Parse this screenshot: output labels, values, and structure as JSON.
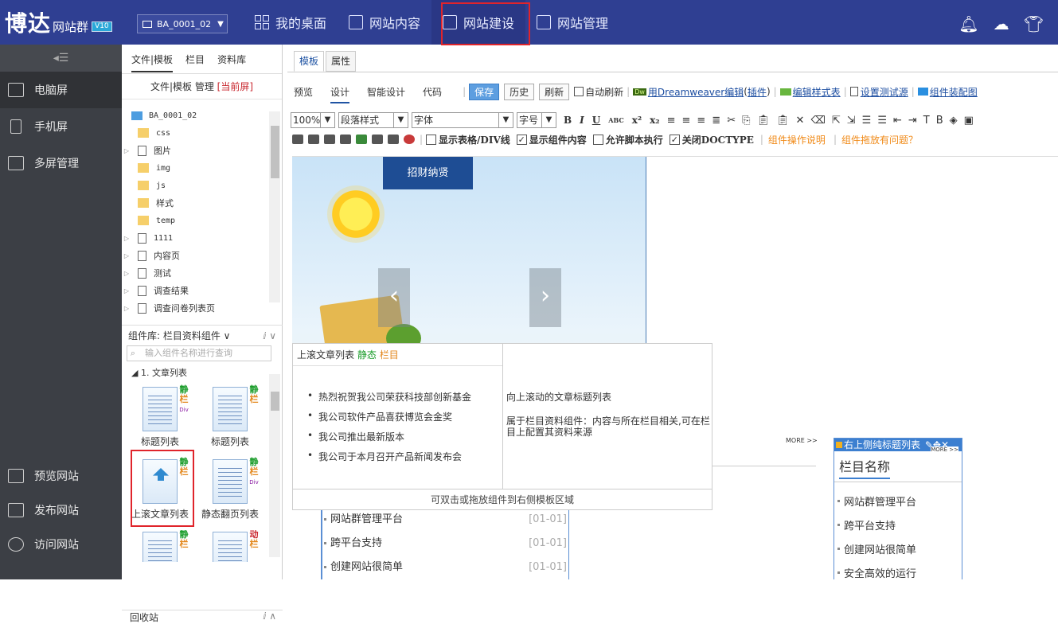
{
  "header": {
    "logo_main": "博达",
    "logo_sub": "网站群",
    "logo_version": "V10",
    "site_code": "BA_0001_02",
    "nav": [
      {
        "label": "我的桌面",
        "icon": "grid-icon"
      },
      {
        "label": "网站内容",
        "icon": "edit-icon"
      },
      {
        "label": "网站建设",
        "icon": "build-icon"
      },
      {
        "label": "网站管理",
        "icon": "manage-icon"
      }
    ],
    "active_nav": "网站建设",
    "right_icons": [
      "bell-icon",
      "cloud-icon",
      "shirt-icon"
    ]
  },
  "sidebar": {
    "collapse_icon": "collapse-icon",
    "top_items": [
      {
        "label": "电脑屏",
        "icon": "desktop-icon",
        "active": true
      },
      {
        "label": "手机屏",
        "icon": "mobile-icon"
      },
      {
        "label": "多屏管理",
        "icon": "multiscreen-icon"
      }
    ],
    "bottom_items": [
      {
        "label": "预览网站",
        "icon": "preview-icon"
      },
      {
        "label": "发布网站",
        "icon": "publish-icon"
      },
      {
        "label": "访问网站",
        "icon": "visit-icon"
      }
    ]
  },
  "midpanel": {
    "tabs": [
      "文件|模板",
      "栏目",
      "资料库"
    ],
    "subtitle": "文件|模板 管理",
    "subtitle_current": "[当前屏]",
    "tree": [
      {
        "label": "BA_0001_02",
        "type": "root"
      },
      {
        "label": "css",
        "type": "folder"
      },
      {
        "label": "图片",
        "type": "image",
        "expandable": true
      },
      {
        "label": "img",
        "type": "folder"
      },
      {
        "label": "js",
        "type": "folder"
      },
      {
        "label": "样式",
        "type": "folder"
      },
      {
        "label": "temp",
        "type": "folder"
      },
      {
        "label": "1111",
        "type": "page",
        "expandable": true
      },
      {
        "label": "内容页",
        "type": "page",
        "expandable": true
      },
      {
        "label": "测试",
        "type": "page",
        "expandable": true
      },
      {
        "label": "调查结果",
        "type": "page",
        "expandable": true
      },
      {
        "label": "调查问卷列表页",
        "type": "page",
        "expandable": true
      }
    ],
    "component_lib_label": "组件库: 栏目资料组件",
    "component_search_placeholder": "输入组件名称进行查询",
    "component_category": "1. 文章列表",
    "components": [
      {
        "label": "标题列表",
        "tag": [
          "静",
          "栏",
          "Div"
        ]
      },
      {
        "label": "标题列表",
        "tag": [
          "静",
          "栏"
        ]
      },
      {
        "label": "上滚文章列表",
        "tag": [
          "静",
          "栏"
        ]
      },
      {
        "label": "静态翻页列表",
        "tag": [
          "静",
          "栏",
          "Div"
        ]
      },
      {
        "label": "",
        "tag": [
          "静",
          "栏"
        ]
      },
      {
        "label": "",
        "tag": [
          "动",
          "栏",
          "Div"
        ]
      }
    ],
    "recycle_label": "回收站"
  },
  "editor": {
    "tabs": [
      "模板",
      "属性"
    ],
    "sub_tabs": [
      "预览",
      "设计",
      "智能设计",
      "代码"
    ],
    "active_sub": "设计",
    "buttons": [
      "保存",
      "历史",
      "刷新"
    ],
    "auto_refresh": "自动刷新",
    "dw_badge": "Dw",
    "dreamweaver_link": "用Dreamweaver编辑",
    "plugin_link": "插件",
    "edit_style_link": "编辑样式表",
    "test_source_link": "设置测试源",
    "layout_link": "组件装配图",
    "zoom": "100%",
    "paragraph": "段落样式",
    "font": "字体",
    "font_size": "字号",
    "opt_table": "显示表格/DIV线",
    "opt_component": "显示组件内容",
    "opt_script": "允许脚本执行",
    "opt_doctype": "关闭DOCTYPE",
    "link_help": "组件操作说明",
    "link_problem": "组件拖放有问题？"
  },
  "canvas": {
    "recruit": "招财纳贤",
    "popup_title": "上滚文章列表",
    "popup_static": "静态",
    "popup_column": "栏目",
    "popup_items": [
      "热烈祝贺我公司荣获科技部创新基金",
      "我公司软件产品喜获博览会金奖",
      "我公司推出最新版本",
      "我公司于本月召开产品新闻发布会"
    ],
    "popup_desc1": "向上滚动的文章标题列表",
    "popup_desc2": "属于栏目资料组件：内容与所在栏目相关,可在栏目上配置其资料来源",
    "popup_footer": "可双击或拖放组件到右侧模板区域",
    "more": "MORE >>",
    "news": [
      {
        "title": "网站群管理平台",
        "date": "[01-01]"
      },
      {
        "title": "跨平台支持",
        "date": "[01-01]"
      },
      {
        "title": "创建网站很简单",
        "date": "[01-01]"
      }
    ],
    "widget_title_bar": "右上侧纯标题列表",
    "widget_more": "MORE >>",
    "widget_heading": "栏目名称",
    "widget_items": [
      "网站群管理平台",
      "跨平台支持",
      "创建网站很简单",
      "安全高效的运行"
    ]
  }
}
